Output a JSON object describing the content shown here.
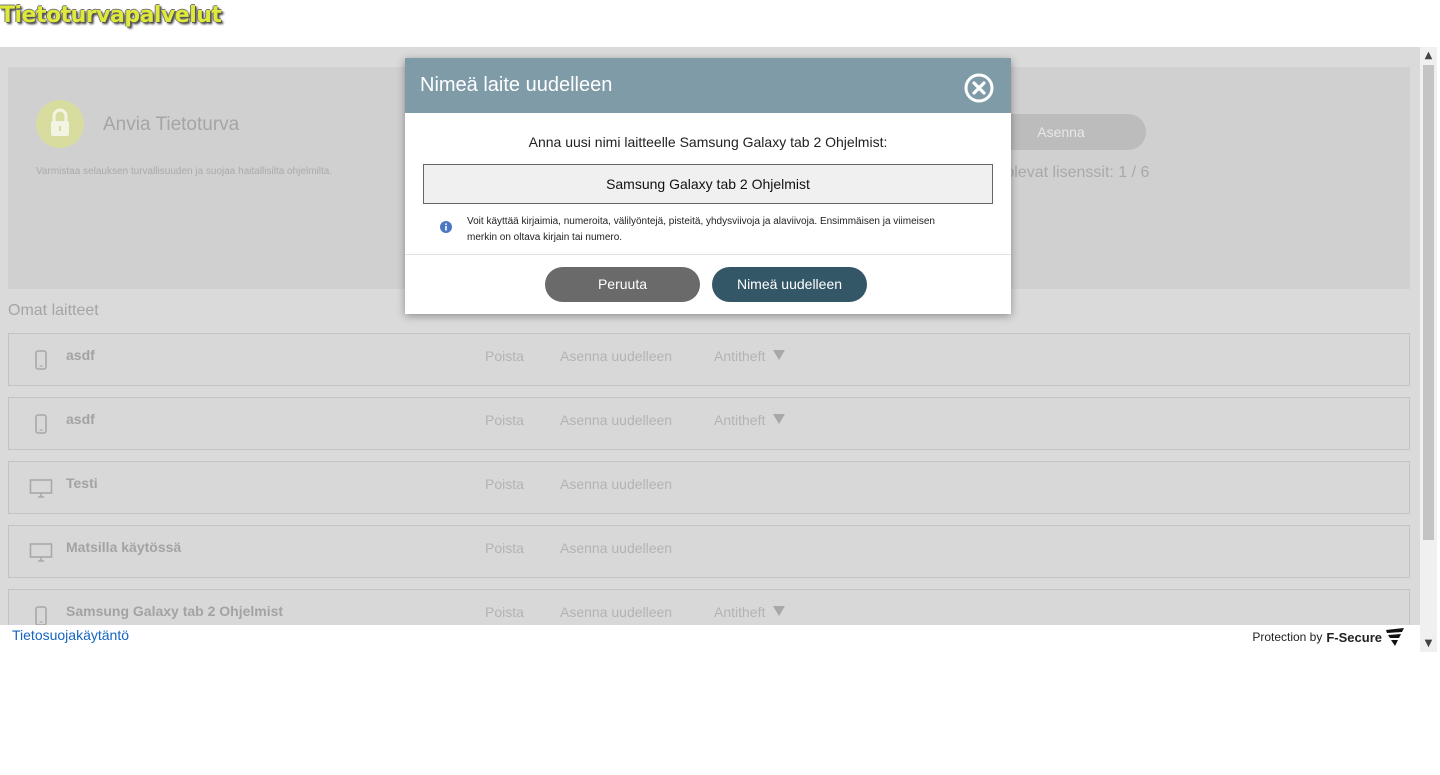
{
  "site": {
    "title": "Tietoturvapalvelut"
  },
  "product": {
    "name": "Anvia Tietoturva",
    "description": "Varmistaa selauksen turvallisuuden ja suojaa haitallisilta ohjelmilta.",
    "install_label": "Asenna",
    "licenses_text": "ssä olevat lisenssit: 1 / 6"
  },
  "devices": {
    "section_title": "Omat laitteet",
    "action_remove": "Poista",
    "action_reinstall": "Asenna uudelleen",
    "action_antitheft": "Antitheft",
    "items": [
      {
        "name": "asdf",
        "type": "phone-icon",
        "antitheft": true
      },
      {
        "name": "asdf",
        "type": "phone-icon",
        "antitheft": true
      },
      {
        "name": "Testi",
        "type": "monitor-icon",
        "antitheft": false
      },
      {
        "name": "Matsilla käytössä",
        "type": "monitor-icon",
        "antitheft": false
      },
      {
        "name": "Samsung Galaxy tab 2 Ohjelmist",
        "type": "phone-icon",
        "antitheft": true
      }
    ]
  },
  "modal": {
    "title": "Nimeä laite uudelleen",
    "prompt": "Anna uusi nimi laitteelle Samsung Galaxy tab 2 Ohjelmist:",
    "input_value": "Samsung Galaxy tab 2 Ohjelmist",
    "info_text": "Voit käyttää kirjaimia, numeroita, välilyöntejä, pisteitä, yhdysviivoja ja alaviivoja. Ensimmäisen ja viimeisen merkin on oltava kirjain tai numero.",
    "cancel_label": "Peruuta",
    "rename_label": "Nimeä uudelleen"
  },
  "footer": {
    "privacy_link": "Tietosuojakäytäntö",
    "protection_by": "Protection by",
    "brand": "F-Secure"
  },
  "colors": {
    "title_yellow": "#dfe93a",
    "modal_header": "#7e9ba7",
    "primary_button": "#345768",
    "secondary_button": "#6a6a6a",
    "link_blue": "#1565c0"
  }
}
